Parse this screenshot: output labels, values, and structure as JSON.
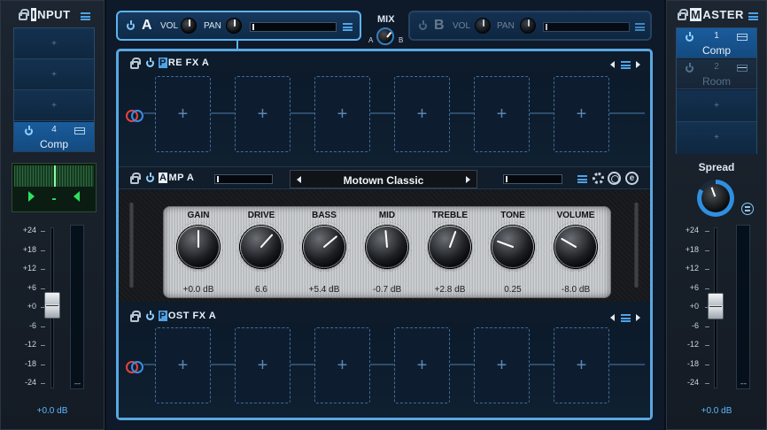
{
  "input_panel": {
    "title_cap": "I",
    "title_rest": "NPUT",
    "slots": [
      {
        "label": "+"
      },
      {
        "label": "+"
      },
      {
        "label": "+"
      }
    ],
    "active_slot": {
      "number": "4",
      "name": "Comp"
    },
    "tuner": {
      "note": "-"
    },
    "scale": [
      "+24",
      "+18",
      "+12",
      "+6",
      "+0",
      "-6",
      "-12",
      "-18",
      "-24"
    ],
    "readout": "+0.0 dB"
  },
  "master_panel": {
    "title_cap": "M",
    "title_rest": "ASTER",
    "active_slot": {
      "number": "1",
      "name": "Comp"
    },
    "bypassed_slot": {
      "number": "2",
      "name": "Room"
    },
    "slots": [
      {
        "label": "+"
      },
      {
        "label": "+"
      }
    ],
    "spread_label": "Spread",
    "scale": [
      "+24",
      "+18",
      "+12",
      "+6",
      "+0",
      "-6",
      "-12",
      "-18",
      "-24"
    ],
    "readout": "+0.0 dB"
  },
  "channel_a": {
    "letter": "A",
    "vol_label": "VOL",
    "pan_label": "PAN"
  },
  "channel_b": {
    "letter": "B",
    "vol_label": "VOL",
    "pan_label": "PAN"
  },
  "mix": {
    "label": "MIX",
    "a": "A",
    "b": "B"
  },
  "pre_fx": {
    "title_cap": "P",
    "title_rest": "RE FX A",
    "slots": [
      "+",
      "+",
      "+",
      "+",
      "+",
      "+"
    ]
  },
  "amp": {
    "title_cap": "A",
    "title_rest": "MP A",
    "preset": "Motown Classic",
    "knobs": [
      {
        "label": "GAIN",
        "value": "+0.0 dB",
        "angle": 0
      },
      {
        "label": "DRIVE",
        "value": "6.6",
        "angle": 42
      },
      {
        "label": "BASS",
        "value": "+5.4 dB",
        "angle": 50
      },
      {
        "label": "MID",
        "value": "-0.7 dB",
        "angle": -5
      },
      {
        "label": "TREBLE",
        "value": "+2.8 dB",
        "angle": 20
      },
      {
        "label": "TONE",
        "value": "0.25",
        "angle": -70
      },
      {
        "label": "VOLUME",
        "value": "-8.0 dB",
        "angle": -60
      }
    ]
  },
  "post_fx": {
    "title_cap": "P",
    "title_rest": "OST FX A",
    "slots": [
      "+",
      "+",
      "+",
      "+",
      "+",
      "+"
    ]
  },
  "colors": {
    "accent": "#4fa3e8",
    "frame": "#5aa7e2",
    "tuner_green": "#2de05e"
  }
}
